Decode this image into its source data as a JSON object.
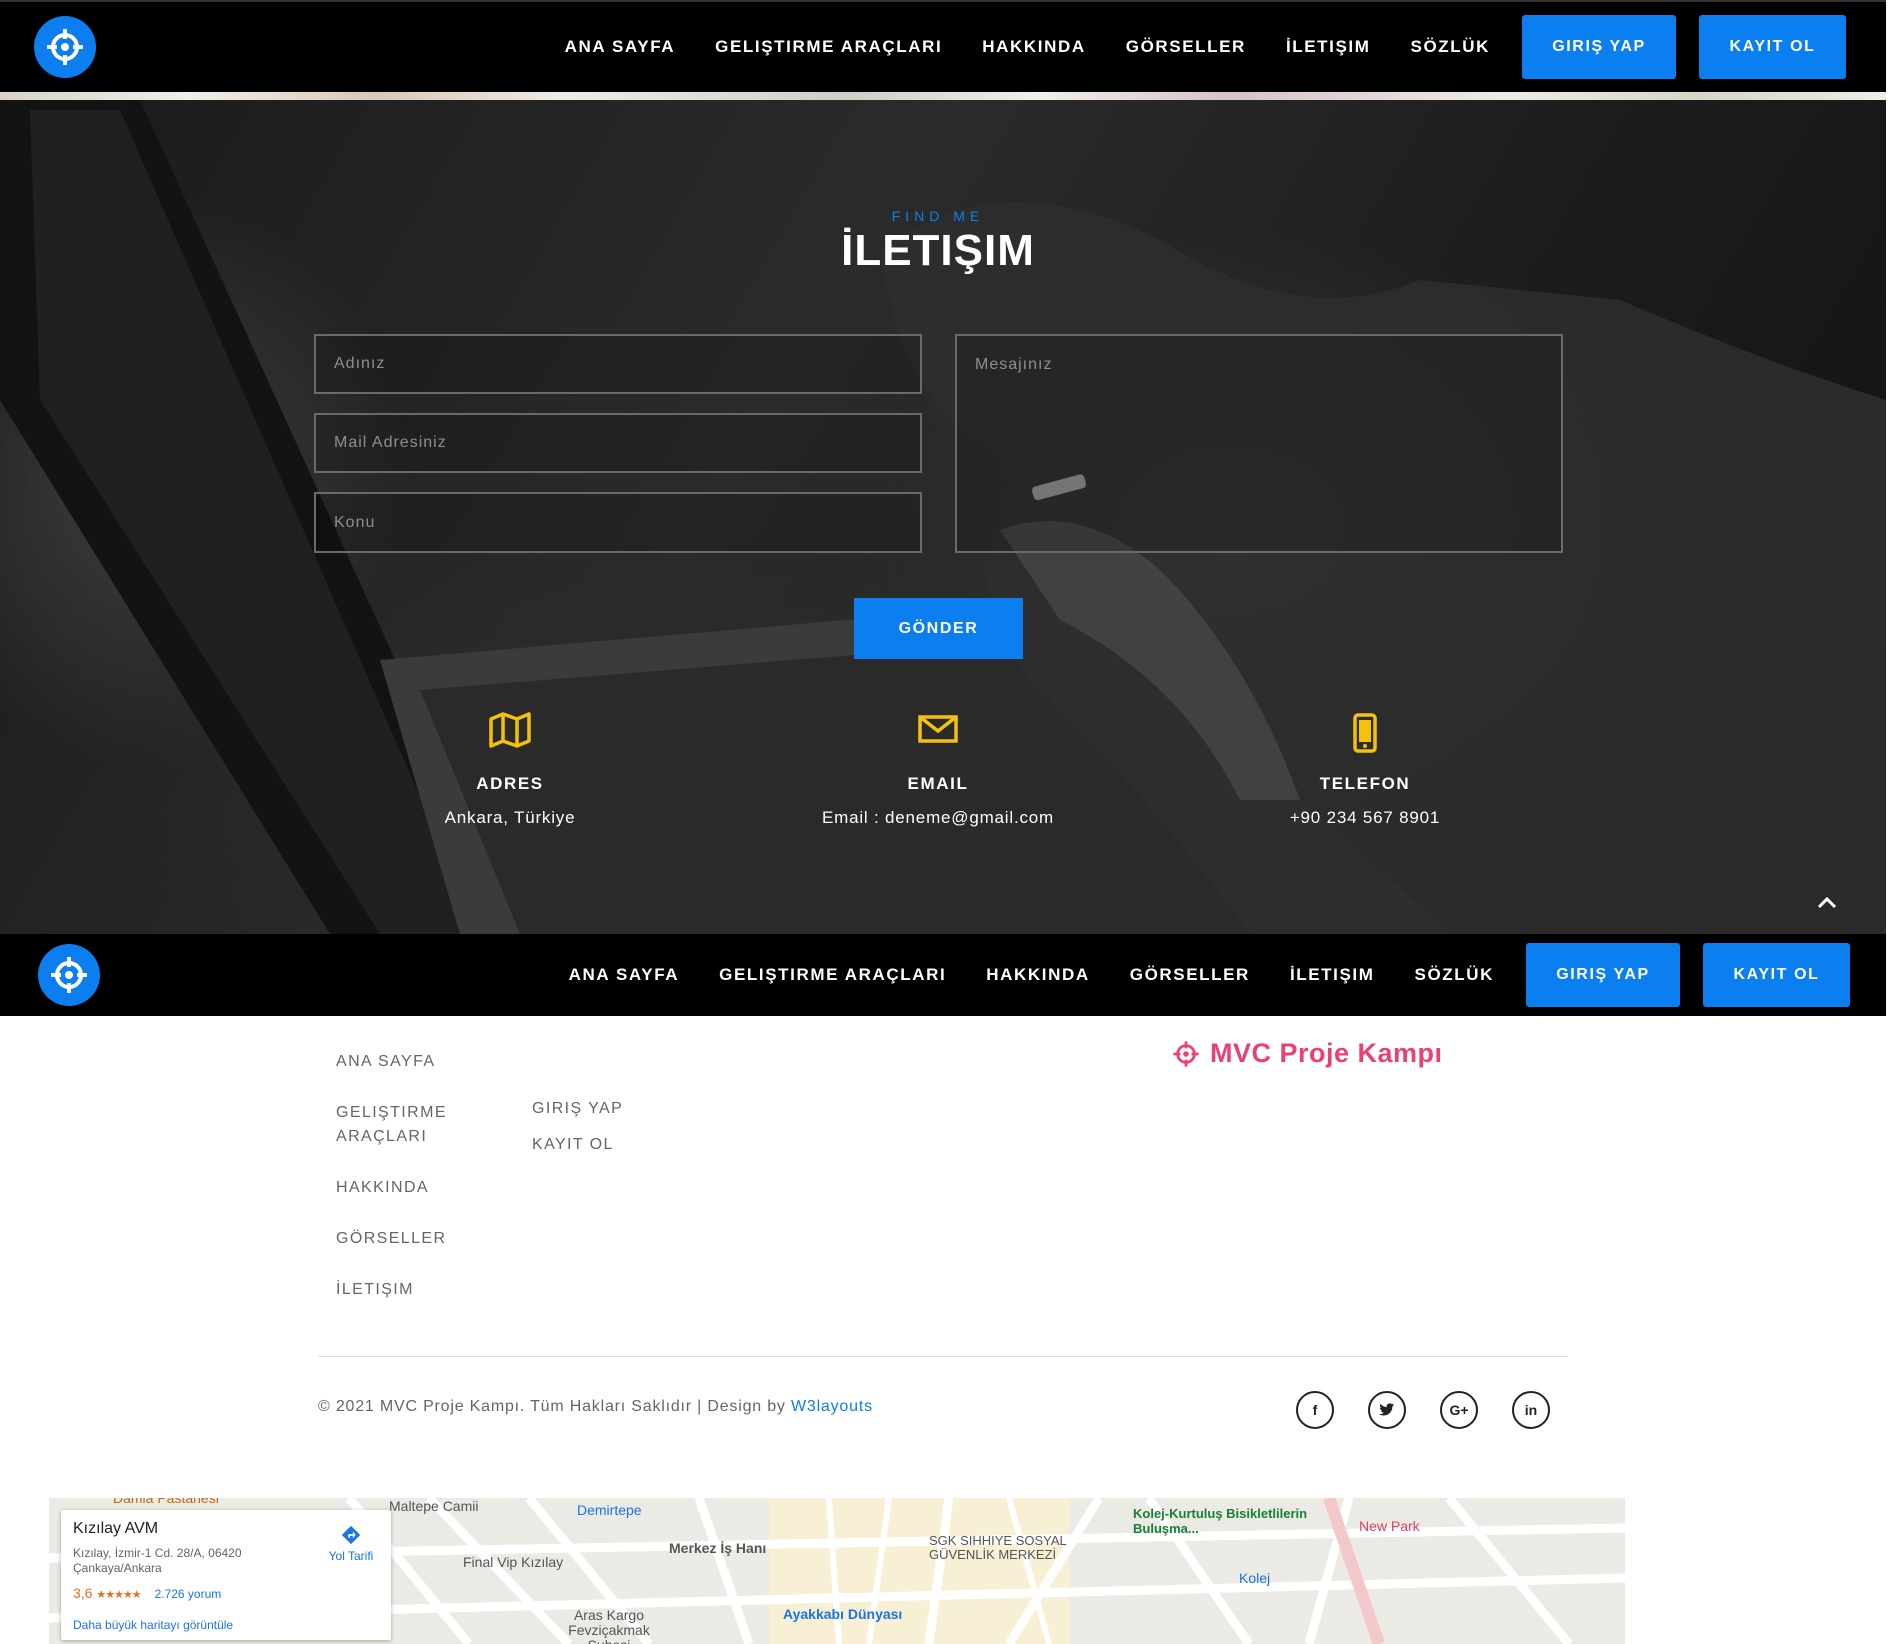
{
  "nav": {
    "links": [
      "ANA SAYFA",
      "GELIŞTIRME ARAÇLARI",
      "HAKKINDA",
      "GÖRSELLER",
      "İLETIŞIM",
      "SÖZLÜK"
    ],
    "login": "GIRIŞ YAP",
    "register": "KAYIT OL"
  },
  "contact": {
    "eyebrow": "FIND ME",
    "title": "İLETIŞIM",
    "name_placeholder": "Adınız",
    "mail_placeholder": "Mail Adresiniz",
    "subject_placeholder": "Konu",
    "message_placeholder": "Mesajınız",
    "submit": "GÖNDER",
    "address": {
      "title": "ADRES",
      "value": "Ankara, Türkiye"
    },
    "email": {
      "title": "EMAIL",
      "value": "Email : deneme@gmail.com"
    },
    "phone": {
      "title": "TELEFON",
      "value": "+90 234 567 8901"
    }
  },
  "footer": {
    "col1": [
      "ANA SAYFA",
      "GELIŞTIRME ARAÇLARI",
      "HAKKINDA",
      "GÖRSELLER",
      "İLETIŞIM"
    ],
    "col2": [
      "GIRIŞ YAP",
      "KAYIT OL"
    ],
    "brand": "MVC Proje Kampı",
    "copyright": "© 2021 MVC Proje Kampı. Tüm Hakları Saklıdır | Design by ",
    "design_link": "W3layouts",
    "socials": [
      "f",
      "t",
      "G+",
      "in"
    ]
  },
  "map": {
    "place_name": "Kızılay AVM",
    "place_address": "Kızılay, İzmir-1 Cd. 28/A, 06420 Çankaya/Ankara",
    "rating": "3,6",
    "stars": "★★★★★",
    "reviews": "2.726 yorum",
    "bigger_map": "Daha büyük haritayı görüntüle",
    "directions": "Yol Tarifi",
    "labels": [
      "Damla Pastanesi",
      "Maltepe Camii",
      "Demirtepe",
      "Final Vip Kızılay",
      "Merkez İş Hanı",
      "SGK SIHHIYE SOSYAL GÜVENLİK MERKEZİ",
      "Kolej-Kurtuluş Bisikletlilerin Buluşma...",
      "New Park",
      "Kolej",
      "Aras Kargo Fevziçakmak Şubesi",
      "Ayakkabı Dünyası"
    ]
  },
  "colors": {
    "accent": "#0b7ef0",
    "brand": "#e9407a",
    "icon_yellow": "#f4c20d"
  },
  "icons": {
    "logo": "crosshair-icon",
    "address": "map-icon",
    "email": "envelope-icon",
    "phone": "mobile-phone-icon",
    "scroll_top": "chevron-up-icon"
  }
}
